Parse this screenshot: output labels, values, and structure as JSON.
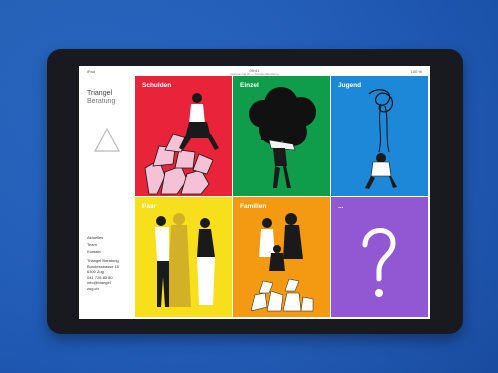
{
  "colors": {
    "background": "#1f5fc4",
    "schulden": "#e8233a",
    "einzel": "#0f9d4c",
    "jugend": "#1e88d8",
    "paar": "#f7e01b",
    "familien": "#f49a12",
    "more": "#9257d2"
  },
  "statusbar": {
    "left": "iPad",
    "center": "09:41",
    "subtitle": "triangel-zug.ch — Triangel Beratung",
    "right": "100 %"
  },
  "sidebar": {
    "brand_line1": "Triangel",
    "brand_line2": "Beratung",
    "logo_icon": "triangle-logo-icon",
    "menu": [
      "Aktuelles",
      "Team",
      "Kontakt"
    ],
    "address": [
      "Triangel Beratung",
      "Bundesstrasse 15",
      "6300 Zug",
      "041 728 80 80",
      "info@triangel",
      "zug.ch"
    ]
  },
  "tiles": [
    {
      "label": "Schulden",
      "illustration": "debt-person-icon"
    },
    {
      "label": "Einzel",
      "illustration": "person-carrying-cloud-icon"
    },
    {
      "label": "Jugend",
      "illustration": "youth-swing-icon"
    },
    {
      "label": "Paar",
      "illustration": "couple-icon"
    },
    {
      "label": "Familien",
      "illustration": "family-icon"
    },
    {
      "label": "...",
      "illustration": "question-mark-icon"
    }
  ]
}
